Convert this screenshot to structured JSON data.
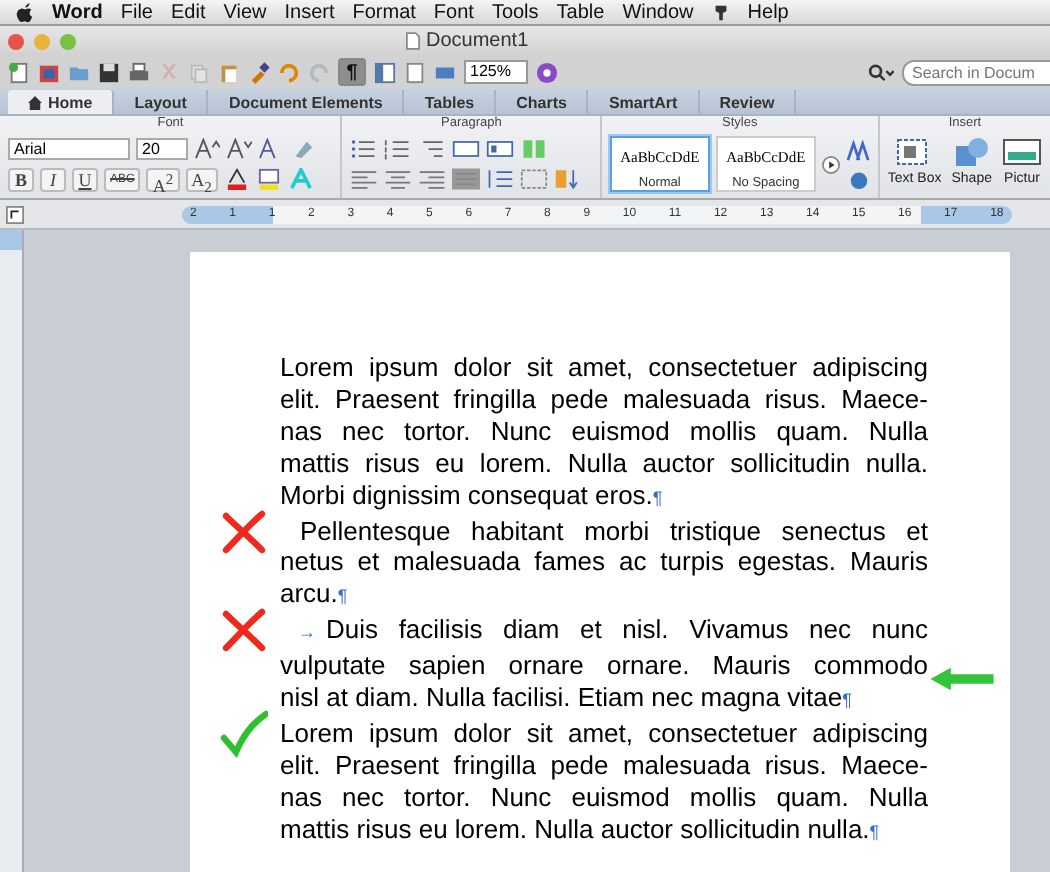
{
  "menu_bar": {
    "app": "Word",
    "items": [
      "File",
      "Edit",
      "View",
      "Insert",
      "Format",
      "Font",
      "Tools",
      "Table",
      "Window",
      "Help"
    ]
  },
  "window": {
    "title": "Document1",
    "zoom": "125%",
    "search_placeholder": "Search in Docum",
    "show_marks": {
      "label": "¶",
      "on": true
    }
  },
  "ribbon_tabs": [
    {
      "label": "Home",
      "selected": true
    },
    {
      "label": "Layout",
      "selected": false
    },
    {
      "label": "Document Elements",
      "selected": false
    },
    {
      "label": "Tables",
      "selected": false
    },
    {
      "label": "Charts",
      "selected": false
    },
    {
      "label": "SmartArt",
      "selected": false
    },
    {
      "label": "Review",
      "selected": false
    }
  ],
  "font_group": {
    "label": "Font",
    "font_name": "Arial",
    "font_size": "20",
    "buttons": [
      "B",
      "I",
      "U",
      "ABC",
      "A$^{2}$",
      "A$_{2}$"
    ]
  },
  "paragraph_group": {
    "label": "Paragraph"
  },
  "styles_group": {
    "label": "Styles",
    "items": [
      {
        "preview": "AaBbCcDdE",
        "name": "Normal",
        "selected": true
      },
      {
        "preview": "AaBbCcDdE",
        "name": "No Spacing",
        "selected": false
      }
    ]
  },
  "insert_group": {
    "label": "Insert",
    "items": [
      "Text Box",
      "Shape",
      "Pictur"
    ]
  },
  "ruler": {
    "numbers": [
      "2",
      "1",
      "1",
      "2",
      "3",
      "4",
      "5",
      "6",
      "7",
      "8",
      "9",
      "10",
      "11",
      "12",
      "13",
      "14",
      "15",
      "16",
      "17",
      "18"
    ]
  },
  "paragraphs": [
    {
      "kind": "plain",
      "crossed": false,
      "checked": false,
      "arrow": false,
      "lines": [
        "Lorem ipsum dolor sit amet, consectetuer adipiscing",
        "elit. Praesent fringilla pede malesuada risus. Maece-",
        "nas nec tortor. Nunc euismod mollis quam. Nulla",
        "mattis risus eu lorem. Nulla auctor sollicitudin nulla.",
        "Morbi dignissim consequat eros."
      ],
      "mark": "¶"
    },
    {
      "kind": "indent",
      "crossed": true,
      "checked": false,
      "arrow": false,
      "lines": [
        "Pellentesque habitant morbi tristique senectus et",
        "netus et malesuada fames ac turpis egestas. Mauris",
        "arcu."
      ],
      "mark": "¶"
    },
    {
      "kind": "tab",
      "tab_mark": "→",
      "crossed": true,
      "checked": false,
      "arrow": true,
      "lines": [
        "Duis facilisis diam et nisl. Vivamus nec nunc",
        "vulputate sapien ornare ornare. Mauris commodo",
        "nisl at diam. Nulla facilisi. Etiam nec magna vitae"
      ],
      "mark": "¶"
    },
    {
      "kind": "plain",
      "crossed": false,
      "checked": true,
      "arrow": false,
      "lines": [
        "Lorem ipsum dolor sit amet, consectetuer adipiscing",
        "elit. Praesent fringilla pede malesuada risus. Maece-",
        "nas nec tortor. Nunc euismod mollis quam. Nulla",
        "mattis risus eu lorem. Nulla auctor sollicitudin nulla."
      ],
      "mark": "¶"
    }
  ]
}
